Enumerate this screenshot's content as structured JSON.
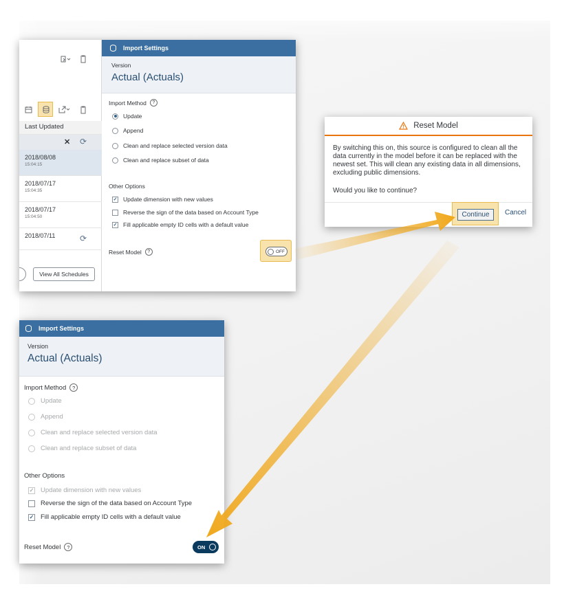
{
  "screenshot1": {
    "left_list": {
      "column_header": "Last Updated",
      "rows": [
        {
          "date": "2018/08/08",
          "time": "15:04:15"
        },
        {
          "date": "2018/07/17",
          "time": "15:04:35"
        },
        {
          "date": "2018/07/17",
          "time": "15:04:50"
        },
        {
          "date": "2018/07/11",
          "time": ""
        }
      ],
      "view_all_label": "View All Schedules"
    },
    "settings": {
      "title": "Import Settings",
      "version_label": "Version",
      "version_value": "Actual (Actuals)",
      "import_method_label": "Import Method",
      "import_methods": [
        "Update",
        "Append",
        "Clean and replace selected version data",
        "Clean and replace subset of data"
      ],
      "other_options_label": "Other Options",
      "other_options": [
        "Update dimension with new values",
        "Reverse the sign of the data based on Account Type",
        "Fill applicable empty ID cells with a default value"
      ],
      "reset_model_label": "Reset Model",
      "toggle_label": "OFF"
    }
  },
  "dialog": {
    "title": "Reset Model",
    "body": "By switching this on, this source is configured to clean all the data currently in the model before it can be replaced with the newest set. This will clean any existing data in all dimensions, excluding public dimensions.",
    "question": "Would you like to continue?",
    "continue_label": "Continue",
    "cancel_label": "Cancel"
  },
  "screenshot2": {
    "settings": {
      "title": "Import Settings",
      "version_label": "Version",
      "version_value": "Actual (Actuals)",
      "import_method_label": "Import Method",
      "import_methods": [
        "Update",
        "Append",
        "Clean and replace selected version data",
        "Clean and replace subset of data"
      ],
      "other_options_label": "Other Options",
      "other_options": [
        "Update dimension with new values",
        "Reverse the sign of the data based on Account Type",
        "Fill applicable empty ID cells with a default value"
      ],
      "reset_model_label": "Reset Model",
      "toggle_label": "ON"
    }
  },
  "colors": {
    "header_blue": "#3b6fa1",
    "highlight_yellow": "#f8e3ad",
    "arrow_orange": "#f0a81c",
    "warning_orange": "#e9730c",
    "toggle_on": "#0a3a5e"
  }
}
